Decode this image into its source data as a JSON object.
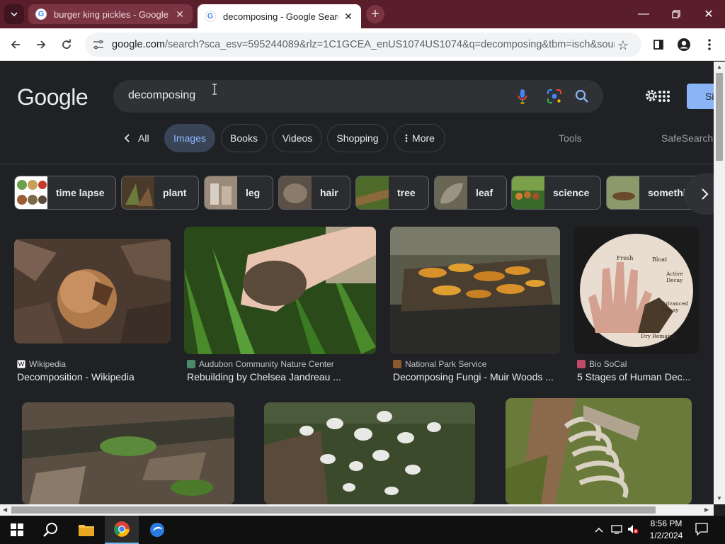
{
  "browser": {
    "tabs": [
      {
        "title": "burger king pickles - Google Se",
        "active": false
      },
      {
        "title": "decomposing - Google Search",
        "active": true
      }
    ],
    "new_tab_symbol": "+",
    "address": {
      "host": "google.com",
      "path": "/search?sca_esv=595244089&rlz=1C1GCEA_enUS1074US1074&q=decomposing&tbm=isch&source..."
    }
  },
  "google": {
    "logo": "Google",
    "query": "decomposing",
    "signin_label": "Si",
    "back_label": "All",
    "filters": [
      "Images",
      "Books",
      "Videos",
      "Shopping",
      "More"
    ],
    "selected_filter": "Images",
    "tools_label": "Tools",
    "safesearch_label": "SafeSearch"
  },
  "related": [
    {
      "label": "time lapse"
    },
    {
      "label": "plant"
    },
    {
      "label": "leg"
    },
    {
      "label": "hair"
    },
    {
      "label": "tree"
    },
    {
      "label": "leaf"
    },
    {
      "label": "science"
    },
    {
      "label": "somethin"
    }
  ],
  "results": [
    {
      "source": "Wikipedia",
      "title": "Decomposition - Wikipedia"
    },
    {
      "source": "Audubon Community Nature Center",
      "title": "Rebuilding by Chelsea Jandreau ..."
    },
    {
      "source": "National Park Service",
      "title": "Decomposing Fungi - Muir Woods ..."
    },
    {
      "source": "Bio SoCal",
      "title": "5 Stages of Human Dec..."
    }
  ],
  "image_labels": {
    "hand_stages": [
      "Fresh",
      "Bloat",
      "Active Decay",
      "Advanced Decay",
      "Dry Remains"
    ]
  },
  "taskbar": {
    "time": "8:56 PM",
    "date": "1/2/2024"
  }
}
